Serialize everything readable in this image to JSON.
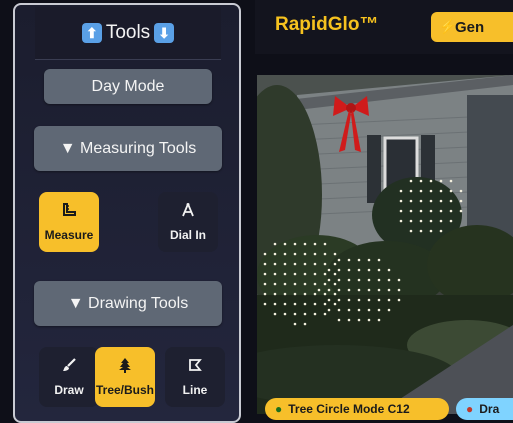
{
  "panel": {
    "title": "Tools",
    "up_icon": "⬆",
    "down_icon": "⬇",
    "day_mode_label": "Day Mode",
    "measuring_label": "▼ Measuring Tools",
    "drawing_label": "▼ Drawing Tools",
    "measuring_tools": [
      {
        "label": "Measure",
        "icon": "ruler-icon",
        "active": true
      },
      {
        "label": "Dial In",
        "icon": "compass-icon",
        "active": false
      }
    ],
    "drawing_tools": [
      {
        "label": "Draw",
        "icon": "brush-icon",
        "active": false
      },
      {
        "label": "Tree/Bush",
        "icon": "tree-icon",
        "active": true
      },
      {
        "label": "Line",
        "icon": "polygon-icon",
        "active": false
      }
    ]
  },
  "header": {
    "brand": "RapidGlo™",
    "gen_label": "Gen"
  },
  "chips": [
    {
      "label": "Tree Circle Mode C12",
      "color": "#f7bf2a"
    },
    {
      "label": "Dra",
      "color": "#7fd3ff"
    }
  ],
  "colors": {
    "accent": "#f7bf2a",
    "panel_button": "#5f6875"
  }
}
